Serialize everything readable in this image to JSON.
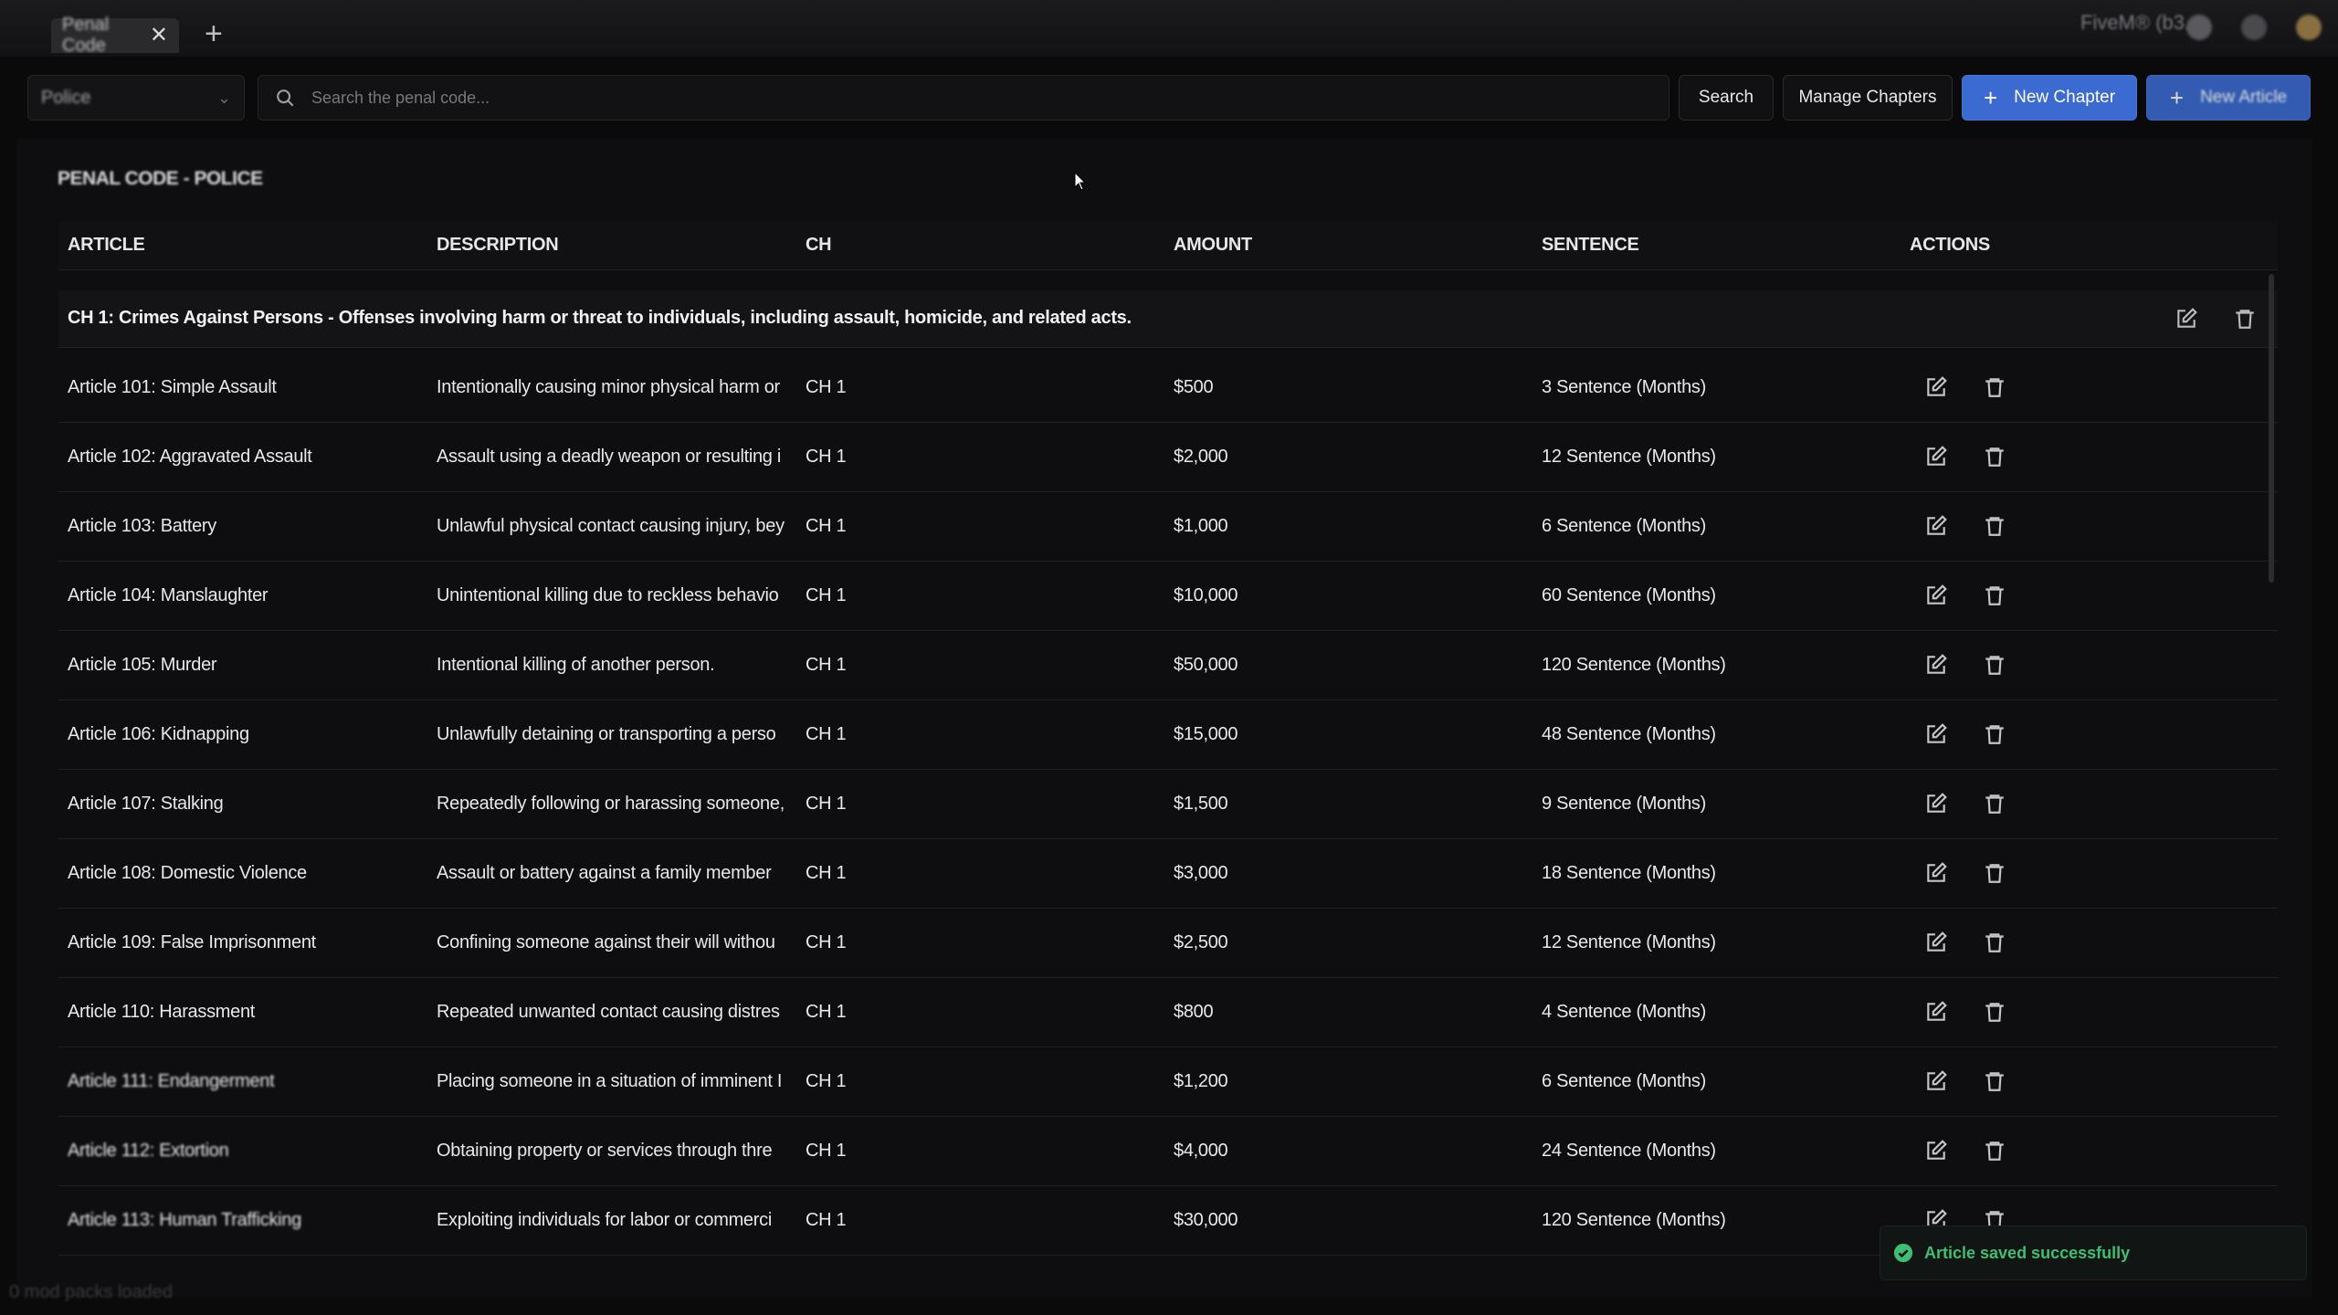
{
  "window": {
    "tab_title": "Penal Code",
    "tab_close": "✕",
    "tab_add": "+",
    "brand": "FiveM® (b3..."
  },
  "toolbar": {
    "department_value": "Police",
    "search_placeholder": "Search the penal code...",
    "search_label": "Search",
    "manage_chapters_label": "Manage Chapters",
    "new_chapter_label": "New Chapter",
    "new_article_label": "New Article"
  },
  "panel": {
    "title": "PENAL CODE - POLICE"
  },
  "table": {
    "headers": {
      "article": "ARTICLE",
      "description": "DESCRIPTION",
      "ch": "CH",
      "amount": "AMOUNT",
      "sentence": "SENTENCE",
      "actions": "ACTIONS"
    },
    "chapter": "CH 1: Crimes Against Persons - Offenses involving harm or threat to individuals, including assault, homicide, and related acts.",
    "rows": [
      {
        "article": "Article 101: Simple Assault",
        "description": "Intentionally causing minor physical harm or",
        "ch": "CH 1",
        "amount": "$500",
        "sentence": "3 Sentence (Months)"
      },
      {
        "article": "Article 102: Aggravated Assault",
        "description": "Assault using a deadly weapon or resulting i",
        "ch": "CH 1",
        "amount": "$2,000",
        "sentence": "12 Sentence (Months)"
      },
      {
        "article": "Article 103: Battery",
        "description": "Unlawful physical contact causing injury, bey",
        "ch": "CH 1",
        "amount": "$1,000",
        "sentence": "6 Sentence (Months)"
      },
      {
        "article": "Article 104: Manslaughter",
        "description": "Unintentional killing due to reckless behavio",
        "ch": "CH 1",
        "amount": "$10,000",
        "sentence": "60 Sentence (Months)"
      },
      {
        "article": "Article 105: Murder",
        "description": "Intentional killing of another person.",
        "ch": "CH 1",
        "amount": "$50,000",
        "sentence": "120 Sentence (Months)"
      },
      {
        "article": "Article 106: Kidnapping",
        "description": "Unlawfully detaining or transporting a perso",
        "ch": "CH 1",
        "amount": "$15,000",
        "sentence": "48 Sentence (Months)"
      },
      {
        "article": "Article 107: Stalking",
        "description": "Repeatedly following or harassing someone,",
        "ch": "CH 1",
        "amount": "$1,500",
        "sentence": "9 Sentence (Months)"
      },
      {
        "article": "Article 108: Domestic Violence",
        "description": "Assault or battery against a family member",
        "ch": "CH 1",
        "amount": "$3,000",
        "sentence": "18 Sentence (Months)"
      },
      {
        "article": "Article 109: False Imprisonment",
        "description": "Confining someone against their will withou",
        "ch": "CH 1",
        "amount": "$2,500",
        "sentence": "12 Sentence (Months)"
      },
      {
        "article": "Article 110: Harassment",
        "description": "Repeated unwanted contact causing distres",
        "ch": "CH 1",
        "amount": "$800",
        "sentence": "4 Sentence (Months)"
      },
      {
        "article": "Article 111: Endangerment",
        "description": "Placing someone in a situation of imminent I",
        "ch": "CH 1",
        "amount": "$1,200",
        "sentence": "6 Sentence (Months)"
      },
      {
        "article": "Article 112: Extortion",
        "description": "Obtaining property or services through thre",
        "ch": "CH 1",
        "amount": "$4,000",
        "sentence": "24 Sentence (Months)"
      },
      {
        "article": "Article 113: Human Trafficking",
        "description": "Exploiting individuals for labor or commerci",
        "ch": "CH 1",
        "amount": "$30,000",
        "sentence": "120 Sentence (Months)"
      }
    ]
  },
  "toast": {
    "message": "Article saved successfully",
    "color": "#3fbf73"
  },
  "footer": {
    "status": "0 mod packs loaded"
  },
  "colors": {
    "accent": "#3b6ad0",
    "background": "#0a0a0b",
    "success": "#3fbf73"
  },
  "icons": [
    "x-icon",
    "plus-icon",
    "chevron-down-icon",
    "search-icon",
    "edit-icon",
    "trash-icon",
    "check-circle-icon",
    "settings-icon"
  ]
}
